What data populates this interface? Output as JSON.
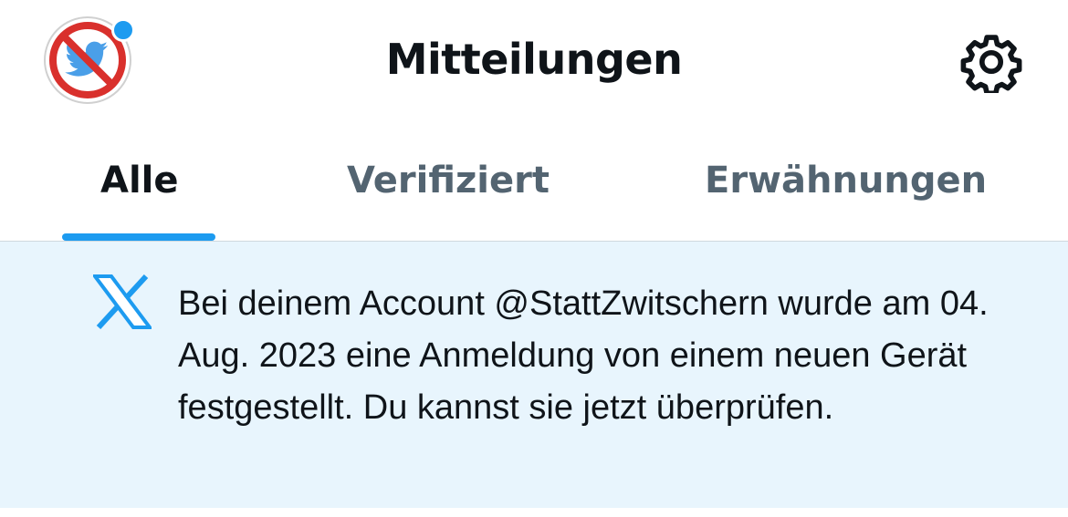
{
  "header": {
    "title": "Mitteilungen",
    "avatar_icon": "no-twitter-bird-icon",
    "settings_icon": "gear-icon"
  },
  "tabs": [
    {
      "label": "Alle",
      "active": true
    },
    {
      "label": "Verifiziert",
      "active": false
    },
    {
      "label": "Erwähnungen",
      "active": false
    }
  ],
  "notification": {
    "icon": "x-logo-icon",
    "text": "Bei deinem Account @StattZwitschern wurde am 04. Aug. 2023 eine Anmeldung von einem neuen Gerät festgestellt. Du kannst sie jetzt überprüfen."
  },
  "colors": {
    "accent": "#1d9bf0",
    "notification_bg": "#e8f5fd",
    "text_primary": "#0f1419",
    "text_secondary": "#536471",
    "prohibition_red": "#d9302c"
  }
}
